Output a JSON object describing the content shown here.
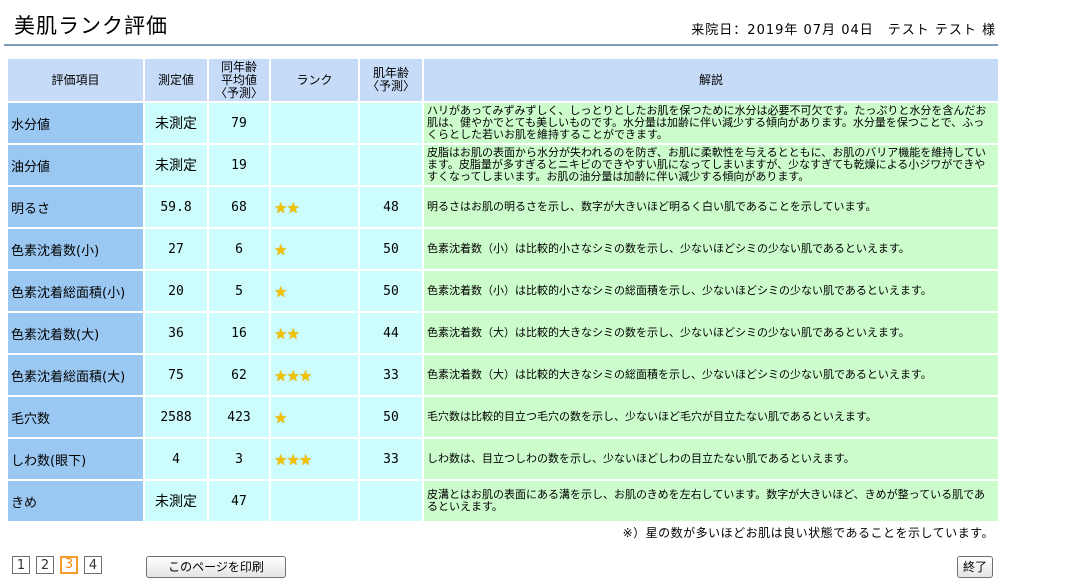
{
  "header": {
    "title": "美肌ランク評価",
    "visit_info": "来院日：2019年 07月 04日　テスト テスト 様"
  },
  "table": {
    "headers": {
      "item": "評価項目",
      "measured": "測定値",
      "avg_line1": "同年齢",
      "avg_line2": "平均値",
      "avg_line3": "〈予測〉",
      "rank": "ランク",
      "skin_age_line1": "肌年齢",
      "skin_age_line2": "〈予測〉",
      "description": "解説"
    },
    "rows": [
      {
        "item": "水分値",
        "measured": "未測定",
        "avg": "79",
        "stars": 0,
        "rank": "",
        "skin_age": "",
        "description": "ハリがあってみずみずしく、しっとりとしたお肌を保つために水分は必要不可欠です。たっぷりと水分を含んだお肌は、健やかでとても美しいものです。水分量は加齢に伴い減少する傾向があります。水分量を保つことで、ふっくらとした若いお肌を維持することができます。"
      },
      {
        "item": "油分値",
        "measured": "未測定",
        "avg": "19",
        "stars": 0,
        "rank": "",
        "skin_age": "",
        "description": "皮脂はお肌の表面から水分が失われるのを防ぎ、お肌に柔軟性を与えるとともに、お肌のバリア機能を維持しています。皮脂量が多すぎるとニキビのできやすい肌になってしまいますが、少なすぎても乾燥による小ジワができやすくなってしまいます。お肌の油分量は加齢に伴い減少する傾向があります。"
      },
      {
        "item": "明るさ",
        "measured": "59.8",
        "avg": "68",
        "stars": 2,
        "rank": "★★",
        "skin_age": "48",
        "description": "明るさはお肌の明るさを示し、数字が大きいほど明るく白い肌であることを示しています。"
      },
      {
        "item": "色素沈着数(小)",
        "measured": "27",
        "avg": "6",
        "stars": 1,
        "rank": "★",
        "skin_age": "50",
        "description": "色素沈着数（小）は比較的小さなシミの数を示し、少ないほどシミの少ない肌であるといえます。"
      },
      {
        "item": "色素沈着総面積(小)",
        "measured": "20",
        "avg": "5",
        "stars": 1,
        "rank": "★",
        "skin_age": "50",
        "description": "色素沈着数（小）は比較的小さなシミの総面積を示し、少ないほどシミの少ない肌であるといえます。"
      },
      {
        "item": "色素沈着数(大)",
        "measured": "36",
        "avg": "16",
        "stars": 2,
        "rank": "★★",
        "skin_age": "44",
        "description": "色素沈着数（大）は比較的大きなシミの数を示し、少ないほどシミの少ない肌であるといえます。"
      },
      {
        "item": "色素沈着総面積(大)",
        "measured": "75",
        "avg": "62",
        "stars": 3,
        "rank": "★★★",
        "skin_age": "33",
        "description": "色素沈着数（大）は比較的大きなシミの総面積を示し、少ないほどシミの少ない肌であるといえます。"
      },
      {
        "item": "毛穴数",
        "measured": "2588",
        "avg": "423",
        "stars": 1,
        "rank": "★",
        "skin_age": "50",
        "description": "毛穴数は比較的目立つ毛穴の数を示し、少ないほど毛穴が目立たない肌であるといえます。"
      },
      {
        "item": "しわ数(眼下)",
        "measured": "4",
        "avg": "3",
        "stars": 3,
        "rank": "★★★",
        "skin_age": "33",
        "description": "しわ数は、目立つしわの数を示し、少ないほどしわの目立たない肌であるといえます。"
      },
      {
        "item": "きめ",
        "measured": "未測定",
        "avg": "47",
        "stars": 0,
        "rank": "",
        "skin_age": "",
        "description": "皮溝とはお肌の表面にある溝を示し、お肌のきめを左右しています。数字が大きいほど、きめが整っている肌であるといえます。"
      }
    ]
  },
  "footnote": "※）星の数が多いほどお肌は良い状態であることを示しています。",
  "pager": {
    "pages": [
      "1",
      "2",
      "3",
      "4"
    ],
    "current": "3"
  },
  "buttons": {
    "print_label": "このページを印刷",
    "end_label": "終了"
  },
  "colors": {
    "header_bg": "#c6dbf7",
    "item_bg": "#9bc8f2",
    "value_bg": "#ccfcfc",
    "description_bg": "#ccfccc",
    "star": "#f2c200",
    "active_page": "#f59a2c"
  },
  "icons": {
    "rank_star": "star-icon"
  }
}
